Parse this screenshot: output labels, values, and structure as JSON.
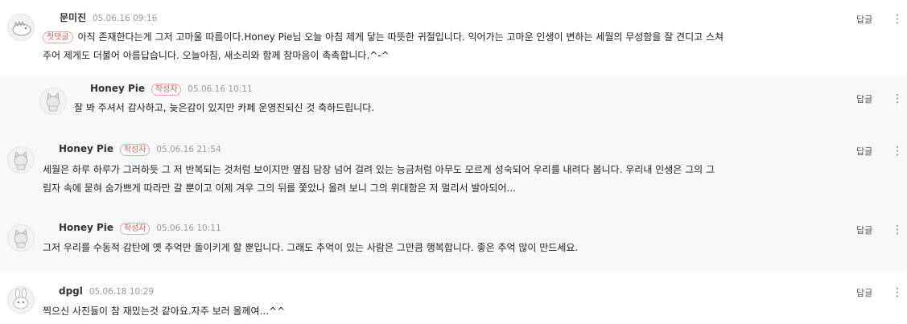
{
  "common": {
    "reply_label": "답글",
    "more_glyph": "⋮"
  },
  "comments": [
    {
      "nickname": "문미진",
      "date": "05.06.16 09:16",
      "first_badge": "첫댓글",
      "line1": "아직 존재한다는게 그저 고마울 따름이다.Honey Pie님 오늘 아침 제게 닿는 따뜻한 귀절입니다. 익어가는 고마운 인생이 변하는 세월의 무성함을 잘 견디고 스쳐",
      "line2": "주어 제게도 더불어 아름답습니다. 오늘아침, 새소리와 함께 참마음이 촉촉합니다.^-^"
    },
    {
      "nickname": "Honey Pie",
      "badge": "작성자",
      "date": "05.06.16 10:11",
      "line1": "잘 봐 주셔서 감사하고, 늦은감이 있지만 카페 운영진되신 것 축하드립니다."
    },
    {
      "nickname": "Honey Pie",
      "badge": "작성자",
      "date": "05.06.16 21:54",
      "line1": "세월은 하루 하루가 그러하듯 그 저 반복되는 것처럼 보이지만 옆집 담장 넘어 걸려 있는 능금처럼 아무도 모르게 성숙되어 우리를 내려다 봅니다. 우리내 인생은 그의 그",
      "line2": "림자 속에 묻혀 숨가쁘게 따라만 갈 뿐이고 이제 겨우 그의 뒤를 쫓았나 올려 보니 그의 위대함은 저 멀리서 발아되어..."
    },
    {
      "nickname": "Honey Pie",
      "badge": "작성자",
      "date": "05.06.16 10:11",
      "line1": "그저 우리를 수동적 감탄에 옛 추억만 돌이키게 할 뿐입니다. 그래도 추억이 있는 사람은 그만큼 행복합니다. 좋은 추억 많이 만드세요."
    },
    {
      "nickname": "dpgl",
      "date": "05.06.18 10:29",
      "line1": "찍으신 사진들이 참 재밌는것 같아요.자주 보러 올께여...^^"
    }
  ]
}
